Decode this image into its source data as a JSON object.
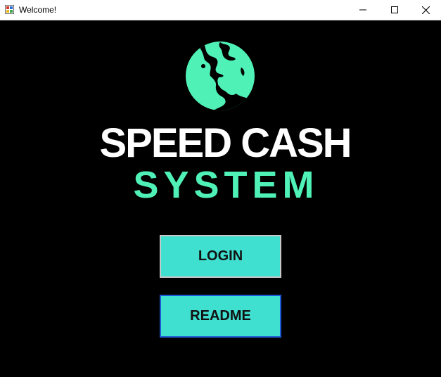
{
  "window": {
    "title": "Welcome!",
    "icons": {
      "app": "app-icon",
      "minimize": "minimize-icon",
      "maximize": "maximize-icon",
      "close": "close-icon"
    }
  },
  "main": {
    "logo_icon": "globe-icon",
    "title_line1": "SPEED CASH",
    "title_line2": "SYSTEM",
    "login_button": "LOGIN",
    "readme_button": "README"
  },
  "colors": {
    "background": "#000000",
    "accent": "#4ff1b6",
    "button_fill": "#40e0d0",
    "button_focus_border": "#1e5ad6"
  }
}
